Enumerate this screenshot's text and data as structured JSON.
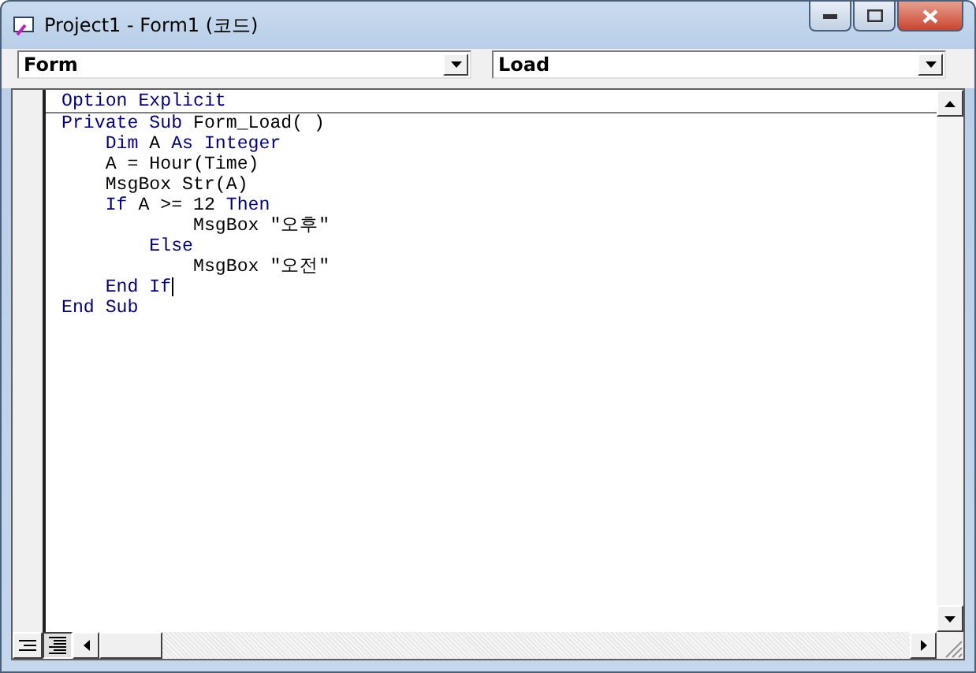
{
  "window": {
    "title": "Project1 - Form1 (코드)"
  },
  "object_combo": {
    "value": "Form"
  },
  "procedure_combo": {
    "value": "Load"
  },
  "code_lines": [
    {
      "tokens": [
        {
          "text": "Option Explicit",
          "kind": "keyword"
        }
      ],
      "separator_below": true,
      "cursor": false
    },
    {
      "tokens": [
        {
          "text": "Private Sub",
          "kind": "keyword"
        },
        {
          "text": " Form_Load( )",
          "kind": "plain"
        }
      ],
      "separator_below": false,
      "cursor": false
    },
    {
      "tokens": [
        {
          "text": "    Dim",
          "kind": "keyword"
        },
        {
          "text": " A ",
          "kind": "plain"
        },
        {
          "text": "As Integer",
          "kind": "keyword"
        }
      ],
      "separator_below": false,
      "cursor": false
    },
    {
      "tokens": [
        {
          "text": "    A = Hour(Time)",
          "kind": "plain"
        }
      ],
      "separator_below": false,
      "cursor": false
    },
    {
      "tokens": [
        {
          "text": "    MsgBox Str(A)",
          "kind": "plain"
        }
      ],
      "separator_below": false,
      "cursor": false
    },
    {
      "tokens": [
        {
          "text": "    If",
          "kind": "keyword"
        },
        {
          "text": " A >= 12 ",
          "kind": "plain"
        },
        {
          "text": "Then",
          "kind": "keyword"
        }
      ],
      "separator_below": false,
      "cursor": false
    },
    {
      "tokens": [
        {
          "text": "            MsgBox \"오후\"",
          "kind": "plain"
        }
      ],
      "separator_below": false,
      "cursor": false
    },
    {
      "tokens": [
        {
          "text": "        Else",
          "kind": "keyword"
        }
      ],
      "separator_below": false,
      "cursor": false
    },
    {
      "tokens": [
        {
          "text": "            MsgBox \"오전\"",
          "kind": "plain"
        }
      ],
      "separator_below": false,
      "cursor": false
    },
    {
      "tokens": [
        {
          "text": "    End If",
          "kind": "keyword"
        }
      ],
      "separator_below": false,
      "cursor": true
    },
    {
      "tokens": [
        {
          "text": "End Sub",
          "kind": "keyword"
        }
      ],
      "separator_below": false,
      "cursor": false
    }
  ]
}
